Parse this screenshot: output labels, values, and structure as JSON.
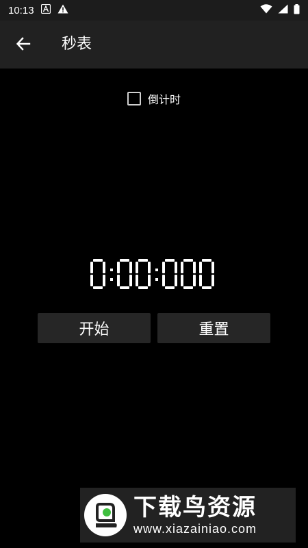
{
  "status_bar": {
    "time": "10:13",
    "icons": [
      "text-a-icon",
      "warning-icon",
      "wifi-icon",
      "signal-icon",
      "battery-icon"
    ]
  },
  "app_bar": {
    "title": "秒表",
    "back_icon": "back-arrow-icon"
  },
  "countdown": {
    "label": "倒计时",
    "checked": false
  },
  "timer": {
    "value": "0:00:000"
  },
  "buttons": {
    "start": "开始",
    "reset": "重置"
  },
  "watermark": {
    "name": "下载鸟资源",
    "url": "www.xiazainiao.com"
  },
  "colors": {
    "background": "#000000",
    "app_bar": "#212121",
    "status_bar": "#1c1c1c",
    "button": "#262626",
    "text": "#ffffff"
  }
}
